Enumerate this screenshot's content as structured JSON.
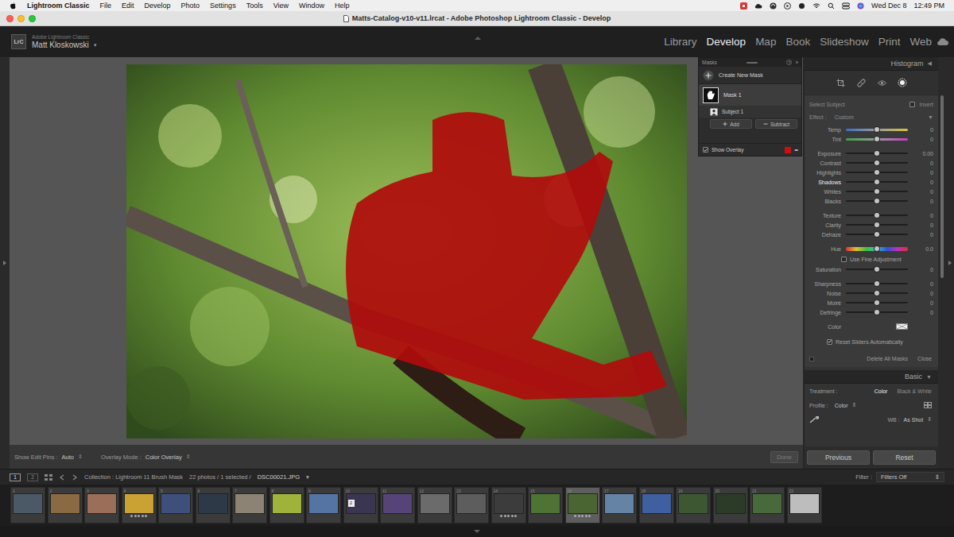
{
  "menubar": {
    "app": "Lightroom Classic",
    "items": [
      "File",
      "Edit",
      "Develop",
      "Photo",
      "Settings",
      "Tools",
      "View",
      "Window",
      "Help"
    ],
    "date": "Wed Dec 8",
    "time": "12:49 PM"
  },
  "window": {
    "title": "Matts-Catalog-v10-v11.lrcat - Adobe Photoshop Lightroom Classic - Develop"
  },
  "identity": {
    "logo": "LrC",
    "product": "Adobe Lightroom Classic",
    "user": "Matt Kloskowski",
    "caret": "▼"
  },
  "modules": [
    {
      "label": "Library",
      "selected": false
    },
    {
      "label": "Develop",
      "selected": true
    },
    {
      "label": "Map",
      "selected": false
    },
    {
      "label": "Book",
      "selected": false
    },
    {
      "label": "Slideshow",
      "selected": false
    },
    {
      "label": "Print",
      "selected": false
    },
    {
      "label": "Web",
      "selected": false
    }
  ],
  "masks_panel": {
    "title": "Masks",
    "help": "?",
    "collapse": "»",
    "create": "Create New Mask",
    "masks": [
      {
        "name": "Mask 1",
        "selected": true,
        "components": [
          {
            "name": "Subject 1",
            "selected": false
          }
        ]
      }
    ],
    "add": "Add",
    "subtract": "Subtract",
    "show_overlay": {
      "label": "Show Overlay",
      "checked": true
    },
    "overlay_color": "#d10d0d",
    "more": "•••"
  },
  "right_panel": {
    "histogram": {
      "label": "Histogram",
      "caret": "◀"
    },
    "tools": [
      {
        "kind": "crop",
        "selected": false
      },
      {
        "kind": "heal",
        "selected": false
      },
      {
        "kind": "redeye",
        "selected": false
      },
      {
        "kind": "mask",
        "selected": true
      }
    ],
    "mask_settings": {
      "title": "Select Subject",
      "invert": {
        "label": "Invert",
        "checked": false
      },
      "effect": {
        "label": "Effect :",
        "value": "Custom",
        "caret": "▼"
      },
      "groups": [
        [
          {
            "label": "Temp",
            "value": "0",
            "level": 0.5,
            "kind": "temp",
            "highlighted": false
          },
          {
            "label": "Tint",
            "value": "0",
            "level": 0.5,
            "kind": "tint",
            "highlighted": false
          }
        ],
        [
          {
            "label": "Exposure",
            "value": "0.00",
            "level": 0.5,
            "kind": "slider",
            "highlighted": false
          },
          {
            "label": "Contrast",
            "value": "0",
            "level": 0.5,
            "kind": "slider",
            "highlighted": false
          },
          {
            "label": "Highlights",
            "value": "0",
            "level": 0.5,
            "kind": "slider",
            "highlighted": false
          },
          {
            "label": "Shadows",
            "value": "0",
            "level": 0.5,
            "kind": "slider",
            "highlighted": true
          },
          {
            "label": "Whites",
            "value": "0",
            "level": 0.5,
            "kind": "slider",
            "highlighted": false
          },
          {
            "label": "Blacks",
            "value": "0",
            "level": 0.5,
            "kind": "slider",
            "highlighted": false
          }
        ],
        [
          {
            "label": "Texture",
            "value": "0",
            "level": 0.5,
            "kind": "slider",
            "highlighted": false
          },
          {
            "label": "Clarity",
            "value": "0",
            "level": 0.5,
            "kind": "slider",
            "highlighted": false
          },
          {
            "label": "Dehaze",
            "value": "0",
            "level": 0.5,
            "kind": "slider",
            "highlighted": false
          }
        ],
        [
          {
            "label": "Hue",
            "value": "0.0",
            "level": 0.5,
            "kind": "hue",
            "highlighted": false
          },
          {
            "label": "Use Fine Adjustment",
            "kind": "check",
            "checked": false
          },
          {
            "label": "Saturation",
            "value": "0",
            "level": 0.5,
            "kind": "slider",
            "highlighted": false
          }
        ],
        [
          {
            "label": "Sharpness",
            "value": "0",
            "level": 0.5,
            "kind": "slider",
            "highlighted": false
          },
          {
            "label": "Noise",
            "value": "0",
            "level": 0.5,
            "kind": "slider",
            "highlighted": false
          },
          {
            "label": "Moiré",
            "value": "0",
            "level": 0.5,
            "kind": "slider",
            "highlighted": false
          },
          {
            "label": "Defringe",
            "value": "0",
            "level": 0.5,
            "kind": "slider",
            "highlighted": false
          }
        ],
        [
          {
            "label": "Color",
            "kind": "color"
          }
        ]
      ],
      "reset_auto": {
        "label": "Reset Sliders Automatically",
        "checked": true
      },
      "delete_all": "Delete All Masks",
      "close": "Close"
    },
    "basic": {
      "title": "Basic",
      "caret": "▼",
      "treatment": {
        "label": "Treatment :",
        "options": [
          {
            "label": "Color",
            "selected": true
          },
          {
            "label": "Black & White",
            "selected": false
          }
        ]
      },
      "profile": {
        "label": "Profile :",
        "value": "Color",
        "caret": "⇕"
      },
      "wb": {
        "label": "WB :",
        "value": "As Shot",
        "caret": "⇕"
      }
    },
    "buttons": [
      "Previous",
      "Reset"
    ]
  },
  "toolbar": {
    "edit_pins": {
      "label": "Show Edit Pins :",
      "value": "Auto",
      "caret": "⇕"
    },
    "overlay_mode": {
      "label": "Overlay Mode :",
      "value": "Color Overlay",
      "caret": "⇕"
    },
    "done": {
      "label": "Done",
      "disabled": true
    }
  },
  "filmstrip": {
    "monitors": [
      {
        "label": "1",
        "selected": true
      },
      {
        "label": "2",
        "selected": false
      }
    ],
    "source": "Collection : Lightroom 11 Brush Mask",
    "count": "22 photos / 1 selected /",
    "file": "DSC00021.JPG",
    "file_caret": "▾",
    "filter_label": "Filter :",
    "filter_value": "Filters Off",
    "filter_caret": "⇕",
    "thumbnails": [
      {
        "number": "1",
        "color": "#4b5966",
        "selected": false,
        "stars": 0
      },
      {
        "number": "2",
        "color": "#8a6a42",
        "selected": false,
        "stars": 0
      },
      {
        "number": "3",
        "color": "#9a6e58",
        "selected": false,
        "stars": 0
      },
      {
        "number": "4",
        "color": "#c9a233",
        "selected": false,
        "stars": 5
      },
      {
        "number": "5",
        "color": "#3d4f7a",
        "selected": false,
        "stars": 0
      },
      {
        "number": "6",
        "color": "#2e3947",
        "selected": false,
        "stars": 0
      },
      {
        "number": "7",
        "color": "#8c8374",
        "selected": false,
        "stars": 0
      },
      {
        "number": "8",
        "color": "#9fb23a",
        "selected": false,
        "stars": 0
      },
      {
        "number": "9",
        "color": "#5574a3",
        "selected": false,
        "stars": 0
      },
      {
        "number": "10",
        "color": "#3a3652",
        "selected": false,
        "stars": 0,
        "badge": "2"
      },
      {
        "number": "11",
        "color": "#564478",
        "selected": false,
        "stars": 0
      },
      {
        "number": "12",
        "color": "#6b6b6b",
        "selected": false,
        "stars": 0
      },
      {
        "number": "13",
        "color": "#5d5d5d",
        "selected": false,
        "stars": 0
      },
      {
        "number": "14",
        "color": "#3c3c3c",
        "selected": false,
        "stars": 5
      },
      {
        "number": "15",
        "color": "#4d7335",
        "selected": false,
        "stars": 0
      },
      {
        "number": "16",
        "color": "#4b6532",
        "selected": true,
        "stars": 5
      },
      {
        "number": "17",
        "color": "#6583a5",
        "selected": false,
        "stars": 0
      },
      {
        "number": "18",
        "color": "#3f5fa0",
        "selected": false,
        "stars": 0
      },
      {
        "number": "19",
        "color": "#3d5733",
        "selected": false,
        "stars": 0
      },
      {
        "number": "20",
        "color": "#2b3b27",
        "selected": false,
        "stars": 0
      },
      {
        "number": "21",
        "color": "#486a3b",
        "selected": false,
        "stars": 0
      },
      {
        "number": "22",
        "color": "#bdbdbd",
        "selected": false,
        "stars": 0
      }
    ]
  }
}
